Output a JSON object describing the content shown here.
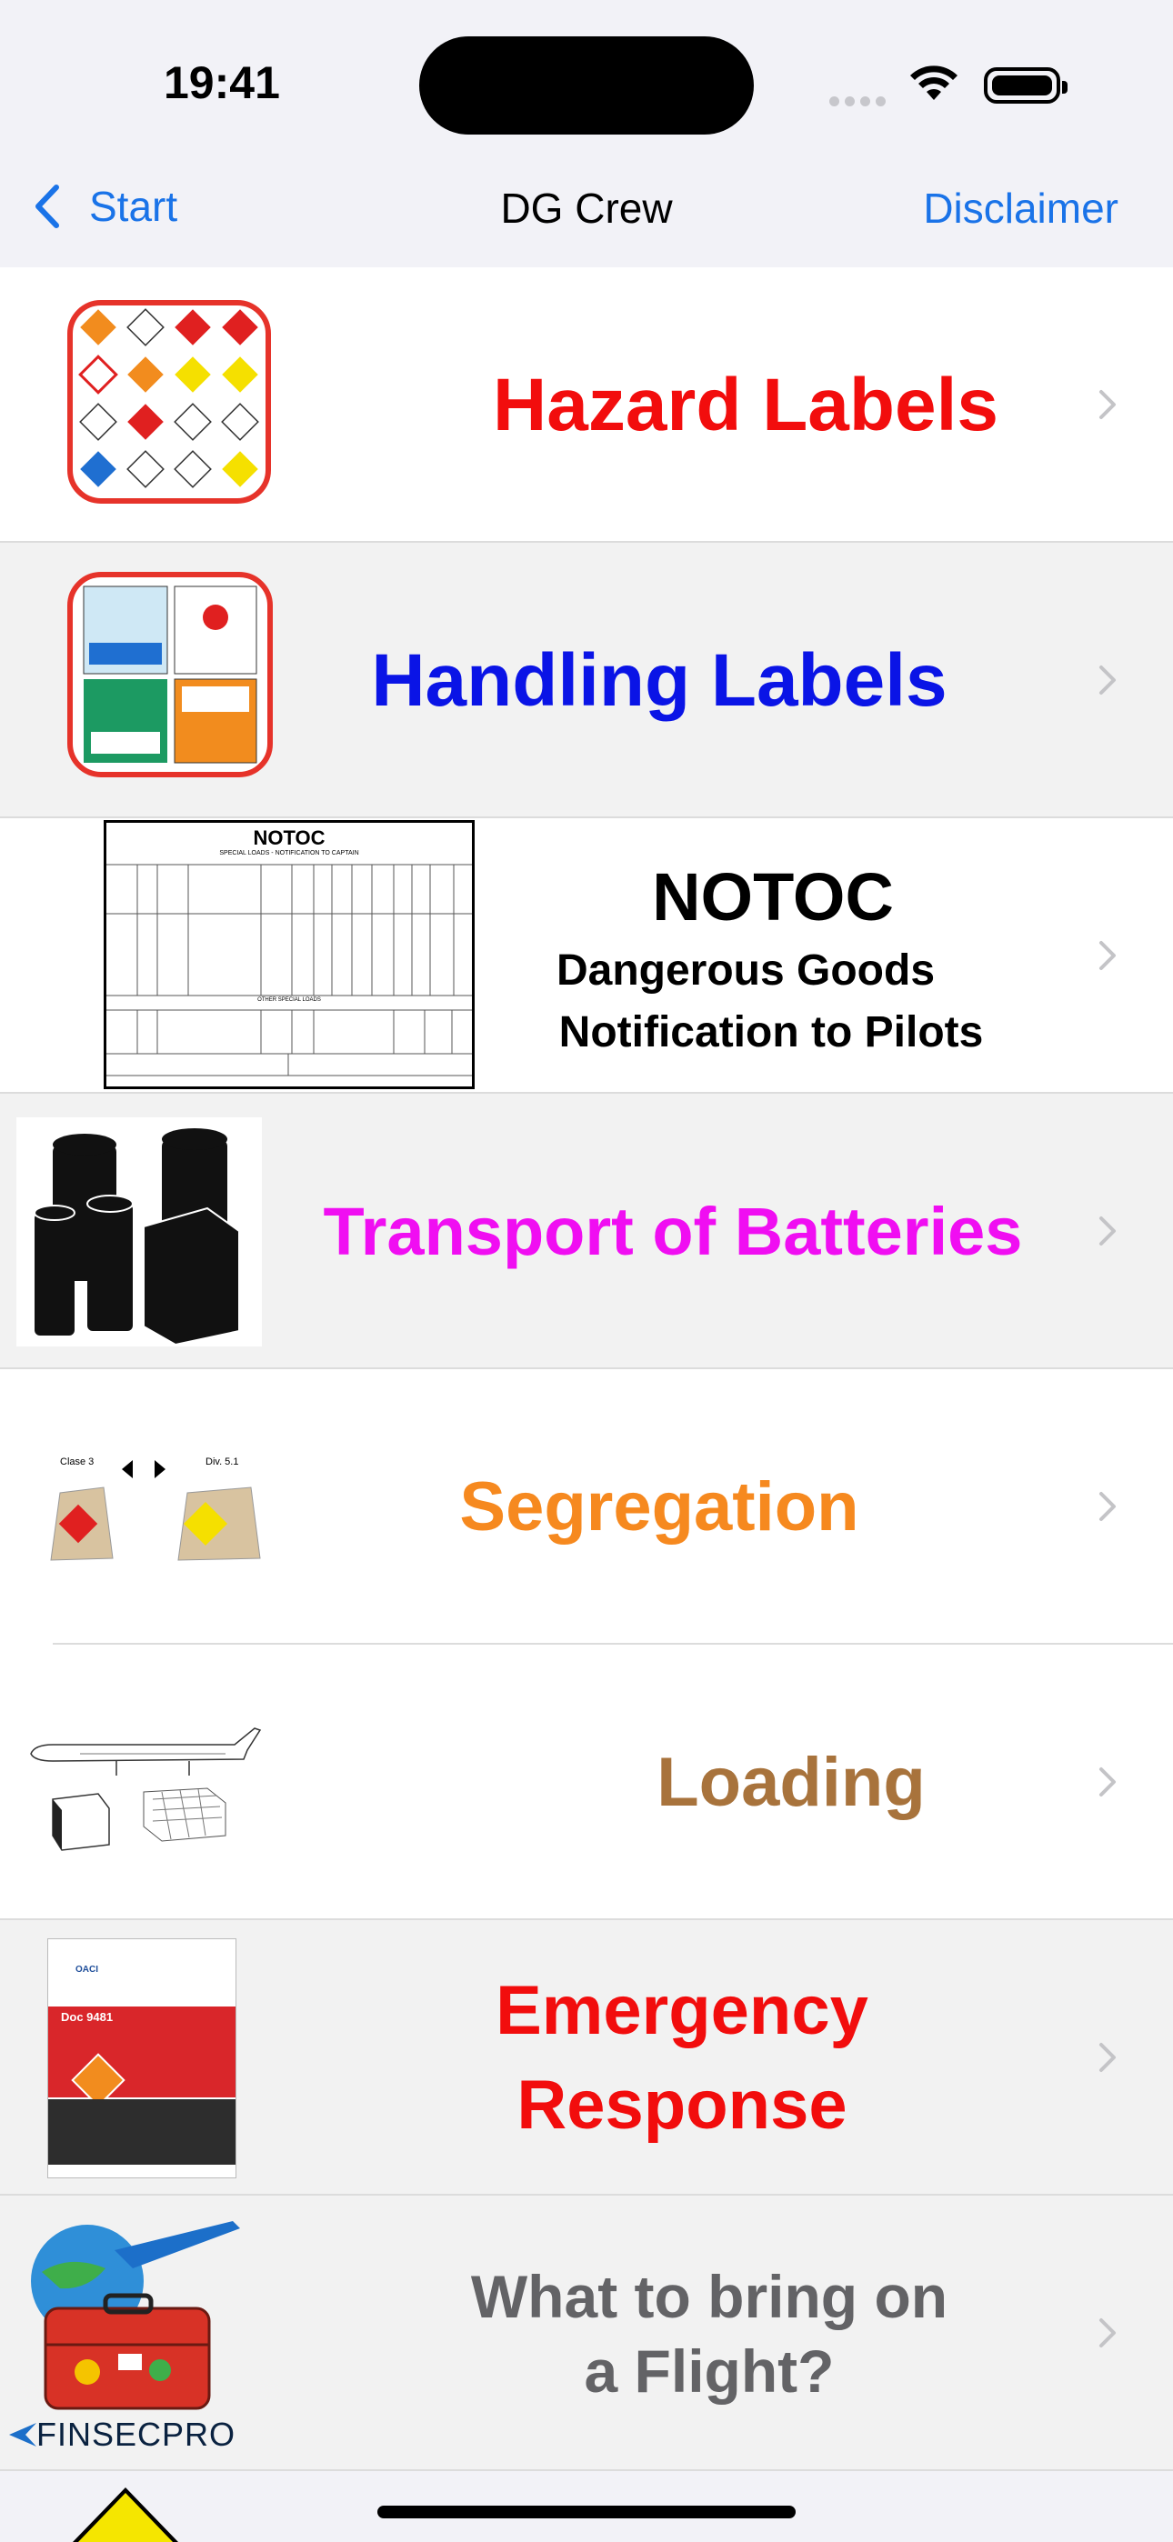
{
  "status": {
    "time": "19:41"
  },
  "nav": {
    "back_label": "Start",
    "title": "DG Crew",
    "right_label": "Disclaimer"
  },
  "rows": [
    {
      "label": "Hazard   Labels",
      "color": "#f20d0d"
    },
    {
      "label": "Handling Labels",
      "color": "#0a14e6"
    },
    {
      "title": "NOTOC",
      "line1": "Dangerous Goods",
      "line2": "Notification to Pilots",
      "color": "#000000",
      "form": {
        "header": "NOTOC",
        "subheader": "SPECIAL LOADS - NOTIFICATION TO CAPTAIN",
        "other_section": "OTHER SPECIAL LOADS"
      }
    },
    {
      "label": "Transport of Batteries",
      "color": "#f00ef2"
    },
    {
      "label": "Segregation",
      "color": "#f6891f",
      "thumb": {
        "left_class": "Clase 3",
        "right_class": "Div. 5.1"
      }
    },
    {
      "label": "Loading",
      "color": "#a8733c"
    },
    {
      "line1": "Emergency",
      "line2": "Response",
      "color": "#f20d0d",
      "thumb": {
        "doc_number": "Doc 9481",
        "agency": "OACI"
      }
    },
    {
      "line1": "What to bring on",
      "line2": "a Flight?",
      "color": "#636366",
      "thumb": {
        "brand": "FINSECPRO"
      }
    }
  ]
}
